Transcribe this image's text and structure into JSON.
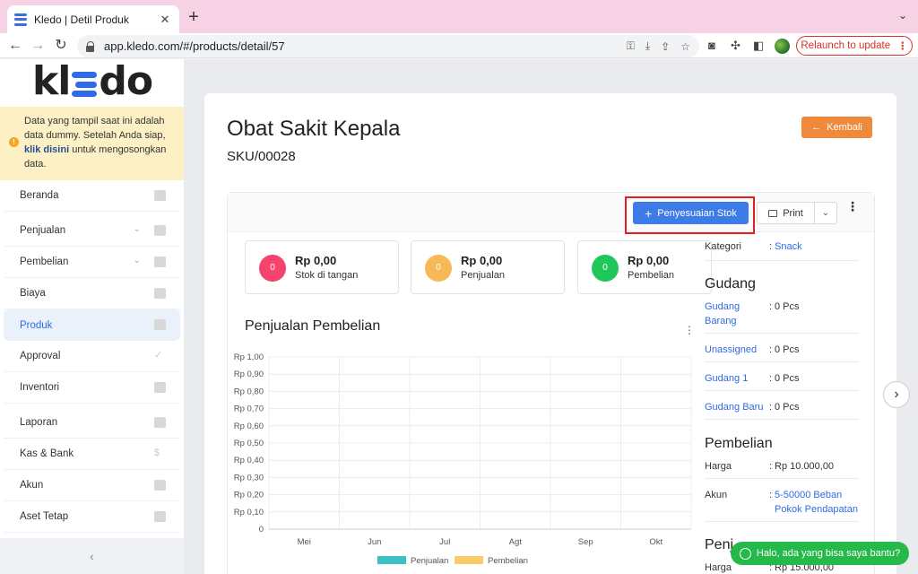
{
  "browser": {
    "tab_title": "Kledo | Detil Produk",
    "url": "app.kledo.com/#/products/detail/57",
    "relaunch_label": "Relaunch to update",
    "relaunch_color": "#d93025"
  },
  "sidebar": {
    "notice_text_1": "Data yang tampil saat ini adalah data dummy. Setelah Anda siap,",
    "notice_link": "klik disini",
    "notice_text_2": "untuk mengosongkan data.",
    "items": [
      {
        "label": "Beranda",
        "icon": "home-icon"
      },
      {
        "label": "Penjualan",
        "icon": "basket-icon"
      },
      {
        "label": "Pembelian",
        "icon": "bag-icon"
      },
      {
        "label": "Biaya",
        "icon": "card-icon"
      },
      {
        "label": "Produk",
        "icon": "box-icon"
      },
      {
        "label": "Approval",
        "icon": "check-icon"
      },
      {
        "label": "Inventori",
        "icon": "warehouse-icon"
      },
      {
        "label": "Laporan",
        "icon": "chart-icon"
      },
      {
        "label": "Kas & Bank",
        "icon": "dollar-icon"
      },
      {
        "label": "Akun",
        "icon": "list-icon"
      },
      {
        "label": "Aset Tetap",
        "icon": "building-icon"
      }
    ],
    "active_item": "Produk"
  },
  "product": {
    "title": "Obat Sakit Kepala",
    "sku": "SKU/00028",
    "back_label": "Kembali"
  },
  "actions": {
    "adjust_label": "Penyesuaian Stok",
    "print_label": "Print"
  },
  "stats": [
    {
      "count": "0",
      "value": "Rp 0,00",
      "label": "Stok di tangan",
      "color": "#f4436c"
    },
    {
      "count": "0",
      "value": "Rp 0,00",
      "label": "Penjualan",
      "color": "#f7b955"
    },
    {
      "count": "0",
      "value": "Rp 0,00",
      "label": "Pembelian",
      "color": "#1fc75b"
    }
  ],
  "chart_data": {
    "type": "bar",
    "title": "Penjualan Pembelian",
    "categories": [
      "Mei",
      "Jun",
      "Jul",
      "Agt",
      "Sep",
      "Okt"
    ],
    "yticks": [
      "Rp 1,00",
      "Rp 0,90",
      "Rp 0,80",
      "Rp 0,70",
      "Rp 0,60",
      "Rp 0,50",
      "Rp 0,40",
      "Rp 0,30",
      "Rp 0,20",
      "Rp 0,10",
      "0"
    ],
    "ylim": [
      0,
      1
    ],
    "series": [
      {
        "name": "Penjualan",
        "values": [
          0,
          0,
          0,
          0,
          0,
          0
        ],
        "color": "#3bc0c3"
      },
      {
        "name": "Pembelian",
        "values": [
          0,
          0,
          0,
          0,
          0,
          0
        ],
        "color": "#f9cc6b"
      }
    ],
    "legend": "bottom"
  },
  "details": {
    "kategori_label": "Kategori",
    "kategori_value": "Snack",
    "gudang_title": "Gudang",
    "gudang": [
      {
        "name": "Gudang Barang",
        "qty": "0 Pcs"
      },
      {
        "name": "Unassigned",
        "qty": "0 Pcs"
      },
      {
        "name": "Gudang 1",
        "qty": "0 Pcs"
      },
      {
        "name": "Gudang Baru",
        "qty": "0 Pcs"
      }
    ],
    "pembelian_title": "Pembelian",
    "harga_label": "Harga",
    "harga_beli": "Rp 10.000,00",
    "akun_label": "Akun",
    "akun_beli": "5-50000 Beban Pokok Pendapatan",
    "penjualan_title": "Penj",
    "harga_jual": "Rp 15.000,00"
  },
  "whatsapp": {
    "label": "Halo, ada yang bisa saya bantu?"
  },
  "colon": ":"
}
